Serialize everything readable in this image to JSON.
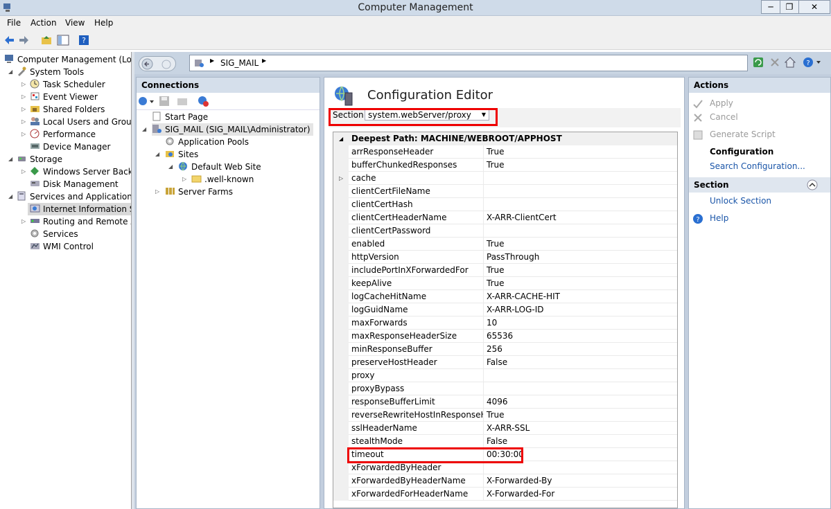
{
  "window": {
    "title": "Computer Management"
  },
  "menu": [
    "File",
    "Action",
    "View",
    "Help"
  ],
  "left_tree": [
    {
      "label": "Computer Management (Local",
      "icon": "computer-management-icon",
      "level": 0
    },
    {
      "label": "System Tools",
      "icon": "tools-icon",
      "level": 1
    },
    {
      "label": "Task Scheduler",
      "icon": "clock-icon",
      "level": 2
    },
    {
      "label": "Event Viewer",
      "icon": "event-viewer-icon",
      "level": 2
    },
    {
      "label": "Shared Folders",
      "icon": "shared-folders-icon",
      "level": 2
    },
    {
      "label": "Local Users and Groups",
      "icon": "users-icon",
      "level": 2
    },
    {
      "label": "Performance",
      "icon": "performance-icon",
      "level": 2
    },
    {
      "label": "Device Manager",
      "icon": "device-manager-icon",
      "level": 2
    },
    {
      "label": "Storage",
      "icon": "storage-icon",
      "level": 1
    },
    {
      "label": "Windows Server Backup",
      "icon": "backup-icon",
      "level": 2
    },
    {
      "label": "Disk Management",
      "icon": "disk-icon",
      "level": 2
    },
    {
      "label": "Services and Applications",
      "icon": "services-apps-icon",
      "level": 1
    },
    {
      "label": "Internet Information Ser",
      "icon": "iis-icon",
      "level": 2
    },
    {
      "label": "Routing and Remote Ac",
      "icon": "routing-icon",
      "level": 2
    },
    {
      "label": "Services",
      "icon": "services-icon",
      "level": 2
    },
    {
      "label": "WMI Control",
      "icon": "wmi-icon",
      "level": 2
    }
  ],
  "address": {
    "path": "SIG_MAIL"
  },
  "connections": {
    "title": "Connections",
    "tree": [
      {
        "label": "Start Page",
        "icon": "start-page-icon"
      },
      {
        "label": "SIG_MAIL (SIG_MAIL\\Administrator)",
        "icon": "server-icon"
      },
      {
        "label": "Application Pools",
        "icon": "app-pools-icon"
      },
      {
        "label": "Sites",
        "icon": "sites-icon"
      },
      {
        "label": "Default Web Site",
        "icon": "globe-icon"
      },
      {
        "label": ".well-known",
        "icon": "folder-icon"
      },
      {
        "label": "Server Farms",
        "icon": "server-farms-icon"
      }
    ]
  },
  "editor": {
    "title": "Configuration Editor",
    "section_label": "Section:",
    "section_value": "system.webServer/proxy",
    "group_header": "Deepest Path: MACHINE/WEBROOT/APPHOST",
    "rows": [
      {
        "key": "arrResponseHeader",
        "value": "True"
      },
      {
        "key": "bufferChunkedResponses",
        "value": "True"
      },
      {
        "key": "cache",
        "value": ""
      },
      {
        "key": "clientCertFileName",
        "value": ""
      },
      {
        "key": "clientCertHash",
        "value": ""
      },
      {
        "key": "clientCertHeaderName",
        "value": "X-ARR-ClientCert"
      },
      {
        "key": "clientCertPassword",
        "value": ""
      },
      {
        "key": "enabled",
        "value": "True"
      },
      {
        "key": "httpVersion",
        "value": "PassThrough"
      },
      {
        "key": "includePortInXForwardedFor",
        "value": "True"
      },
      {
        "key": "keepAlive",
        "value": "True"
      },
      {
        "key": "logCacheHitName",
        "value": "X-ARR-CACHE-HIT"
      },
      {
        "key": "logGuidName",
        "value": "X-ARR-LOG-ID"
      },
      {
        "key": "maxForwards",
        "value": "10"
      },
      {
        "key": "maxResponseHeaderSize",
        "value": "65536"
      },
      {
        "key": "minResponseBuffer",
        "value": "256"
      },
      {
        "key": "preserveHostHeader",
        "value": "False"
      },
      {
        "key": "proxy",
        "value": ""
      },
      {
        "key": "proxyBypass",
        "value": ""
      },
      {
        "key": "responseBufferLimit",
        "value": "4096"
      },
      {
        "key": "reverseRewriteHostInResponseHead",
        "value": "True"
      },
      {
        "key": "sslHeaderName",
        "value": "X-ARR-SSL"
      },
      {
        "key": "stealthMode",
        "value": "False"
      },
      {
        "key": "timeout",
        "value": "00:30:00"
      },
      {
        "key": "xForwardedByHeader",
        "value": ""
      },
      {
        "key": "xForwardedByHeaderName",
        "value": "X-Forwarded-By"
      },
      {
        "key": "xForwardedForHeaderName",
        "value": "X-Forwarded-For"
      }
    ]
  },
  "actions": {
    "title": "Actions",
    "apply": "Apply",
    "cancel": "Cancel",
    "generate_script": "Generate Script",
    "configuration": "Configuration",
    "search_configuration": "Search Configuration...",
    "section_title": "Section",
    "unlock_section": "Unlock Section",
    "help": "Help"
  },
  "colors": {
    "highlight_box": "#e00000",
    "link": "#1a55a8",
    "header_bg": "#d5dfeb"
  }
}
